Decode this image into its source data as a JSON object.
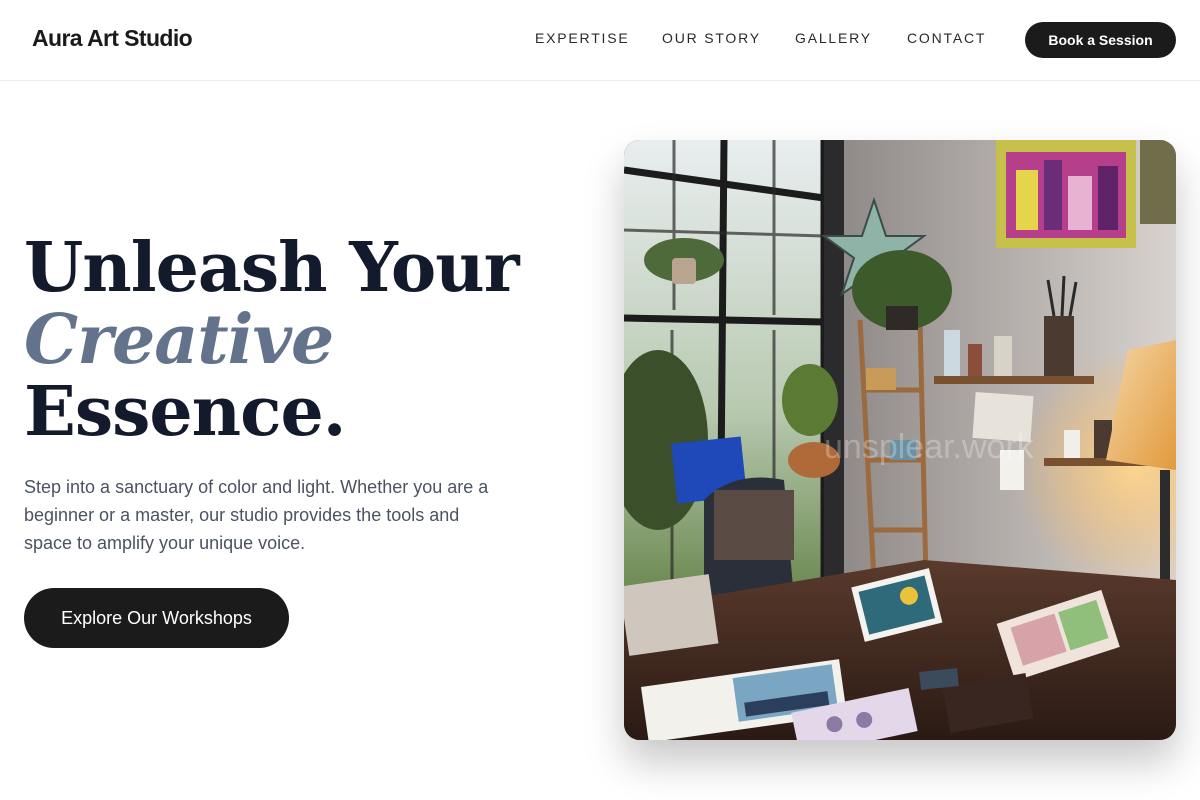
{
  "header": {
    "brand": "Aura Art Studio",
    "nav": [
      "EXPERTISE",
      "OUR STORY",
      "GALLERY",
      "CONTACT"
    ],
    "cta_label": "Book a Session"
  },
  "hero": {
    "headline": {
      "line1": "Unleash Your",
      "line2": "Creative",
      "line3": "Essence."
    },
    "lead": "Step into a sanctuary of color and light. Whether you are a beginner or a master, our studio provides the tools and space to amplify your unique voice.",
    "cta_label": "Explore Our Workshops"
  },
  "image": {
    "watermark": "unsplear.work"
  },
  "colors": {
    "primary_dark": "#1b1b1b",
    "headline": "#131a2c",
    "accent_slate": "#64738c",
    "body_text": "#4b5361"
  }
}
